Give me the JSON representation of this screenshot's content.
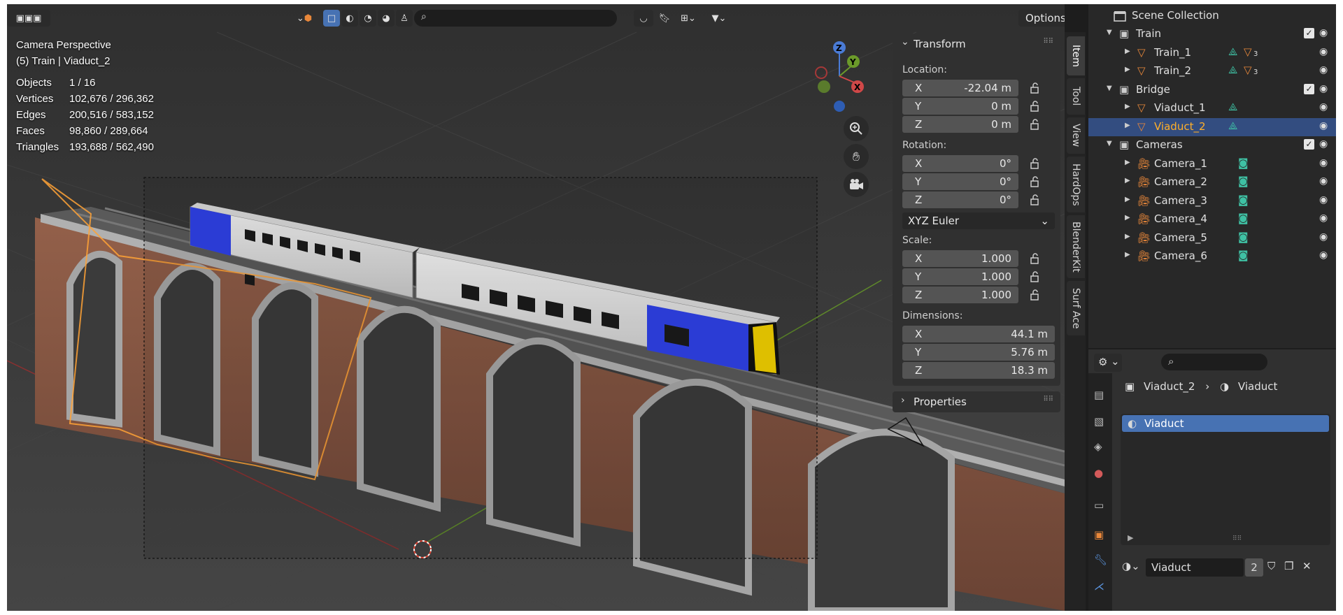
{
  "viewport": {
    "overlay": {
      "mode": "Camera Perspective",
      "context": "(5) Train | Viaduct_2",
      "stats": [
        {
          "label": "Objects",
          "value": "1 / 16"
        },
        {
          "label": "Vertices",
          "value": "102,676 / 296,362"
        },
        {
          "label": "Edges",
          "value": "200,516 / 583,152"
        },
        {
          "label": "Faces",
          "value": "98,860 / 289,664"
        },
        {
          "label": "Triangles",
          "value": "193,688 / 562,490"
        }
      ]
    },
    "options_label": "Options",
    "gizmo": {
      "z": "Z",
      "y": "Y",
      "x": "X"
    }
  },
  "npanel": {
    "transform_title": "Transform",
    "location_label": "Location:",
    "location": [
      {
        "axis": "X",
        "value": "-22.04 m"
      },
      {
        "axis": "Y",
        "value": "0 m"
      },
      {
        "axis": "Z",
        "value": "0 m"
      }
    ],
    "rotation_label": "Rotation:",
    "rotation": [
      {
        "axis": "X",
        "value": "0°"
      },
      {
        "axis": "Y",
        "value": "0°"
      },
      {
        "axis": "Z",
        "value": "0°"
      }
    ],
    "rotation_mode": "XYZ Euler",
    "scale_label": "Scale:",
    "scale": [
      {
        "axis": "X",
        "value": "1.000"
      },
      {
        "axis": "Y",
        "value": "1.000"
      },
      {
        "axis": "Z",
        "value": "1.000"
      }
    ],
    "dimensions_label": "Dimensions:",
    "dimensions": [
      {
        "axis": "X",
        "value": "44.1 m"
      },
      {
        "axis": "Y",
        "value": "5.76 m"
      },
      {
        "axis": "Z",
        "value": "18.3 m"
      }
    ],
    "properties_title": "Properties",
    "tabs": [
      "Item",
      "Tool",
      "View",
      "HardOps",
      "BlenderKit",
      "Surf Ace"
    ]
  },
  "outliner": {
    "root": "Scene Collection",
    "rows": [
      {
        "label": "Train",
        "type": "collection",
        "indent": 1
      },
      {
        "label": "Train_1",
        "type": "mesh",
        "indent": 2,
        "modifier_count": "3"
      },
      {
        "label": "Train_2",
        "type": "mesh",
        "indent": 2,
        "modifier_count": "3"
      },
      {
        "label": "Bridge",
        "type": "collection",
        "indent": 1
      },
      {
        "label": "Viaduct_1",
        "type": "mesh",
        "indent": 2
      },
      {
        "label": "Viaduct_2",
        "type": "mesh",
        "indent": 2,
        "selected": true
      },
      {
        "label": "Cameras",
        "type": "collection",
        "indent": 1
      },
      {
        "label": "Camera_1",
        "type": "camera",
        "indent": 2
      },
      {
        "label": "Camera_2",
        "type": "camera",
        "indent": 2
      },
      {
        "label": "Camera_3",
        "type": "camera",
        "indent": 2
      },
      {
        "label": "Camera_4",
        "type": "camera",
        "indent": 2
      },
      {
        "label": "Camera_5",
        "type": "camera",
        "indent": 2
      },
      {
        "label": "Camera_6",
        "type": "camera",
        "indent": 2
      }
    ]
  },
  "properties": {
    "breadcrumb_object": "Viaduct_2",
    "breadcrumb_material": "Viaduct",
    "material_slot": "Viaduct",
    "material_name": "Viaduct",
    "user_count": "2"
  },
  "colors": {
    "accent": "#4772b3",
    "selected_text": "#ffaf29",
    "mesh_icon": "#e8873a",
    "data_icon": "#3fc1a4",
    "brick": "#8a5a44",
    "stone": "#a8a8a8",
    "train_blue": "#2a3fe0"
  }
}
